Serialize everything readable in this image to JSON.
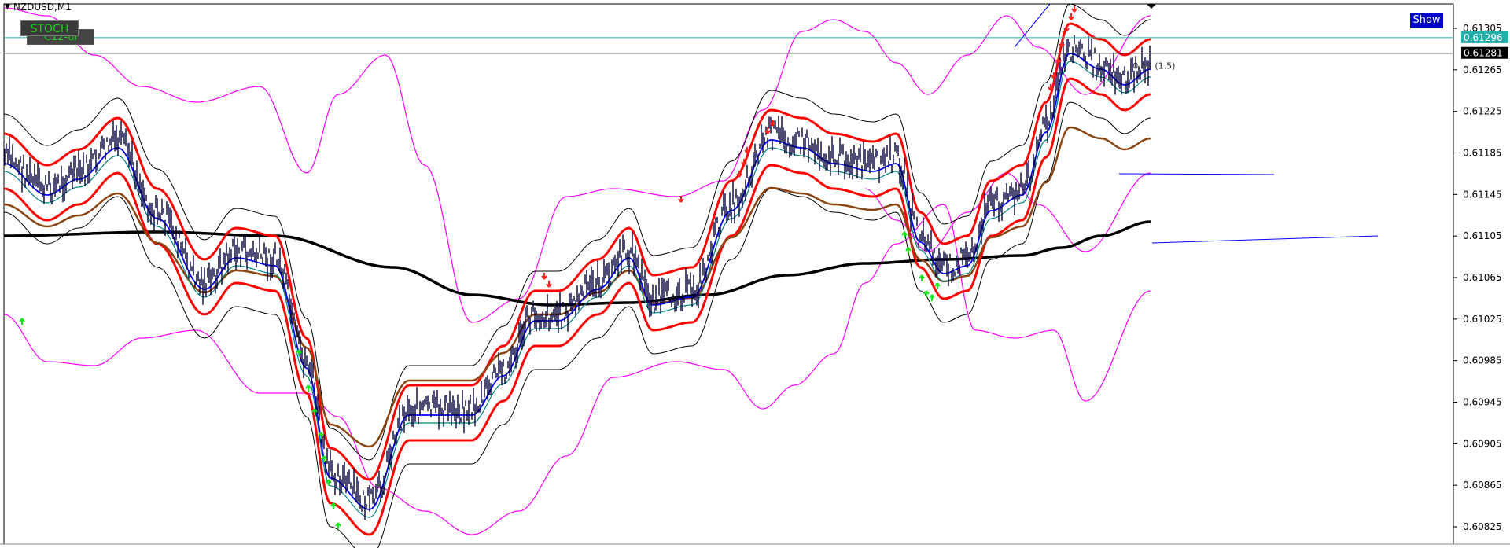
{
  "chart": {
    "symbol": "NZDUSD,M1",
    "buttons": {
      "stoch": "STOCH",
      "c12": "C12-ui",
      "show": "Show"
    },
    "price_axis": {
      "ticks": [
        "0.61305",
        "0.61265",
        "0.61225",
        "0.61185",
        "0.61145",
        "0.61105",
        "0.61065",
        "0.61025",
        "0.60985",
        "0.60945",
        "0.60905",
        "0.60865",
        "0.60825"
      ],
      "current_price": "0.61296",
      "ask_price": "0.61281",
      "current_price_color": "#20b2aa",
      "ask_price_color": "#000000"
    },
    "annotation": "0.53 (1.5)",
    "colors": {
      "candles": "#00003c",
      "envelope_bands": "#ff00ff",
      "bollinger_bands": "#000000",
      "red_bands": "#ff0000",
      "blue_ma": "#0000ff",
      "teal_ma": "#008080",
      "brown_ma": "#8b4513",
      "long_ma": "#000000",
      "buy_arrows": "#19e619",
      "sell_arrows": "#ff2020"
    }
  }
}
